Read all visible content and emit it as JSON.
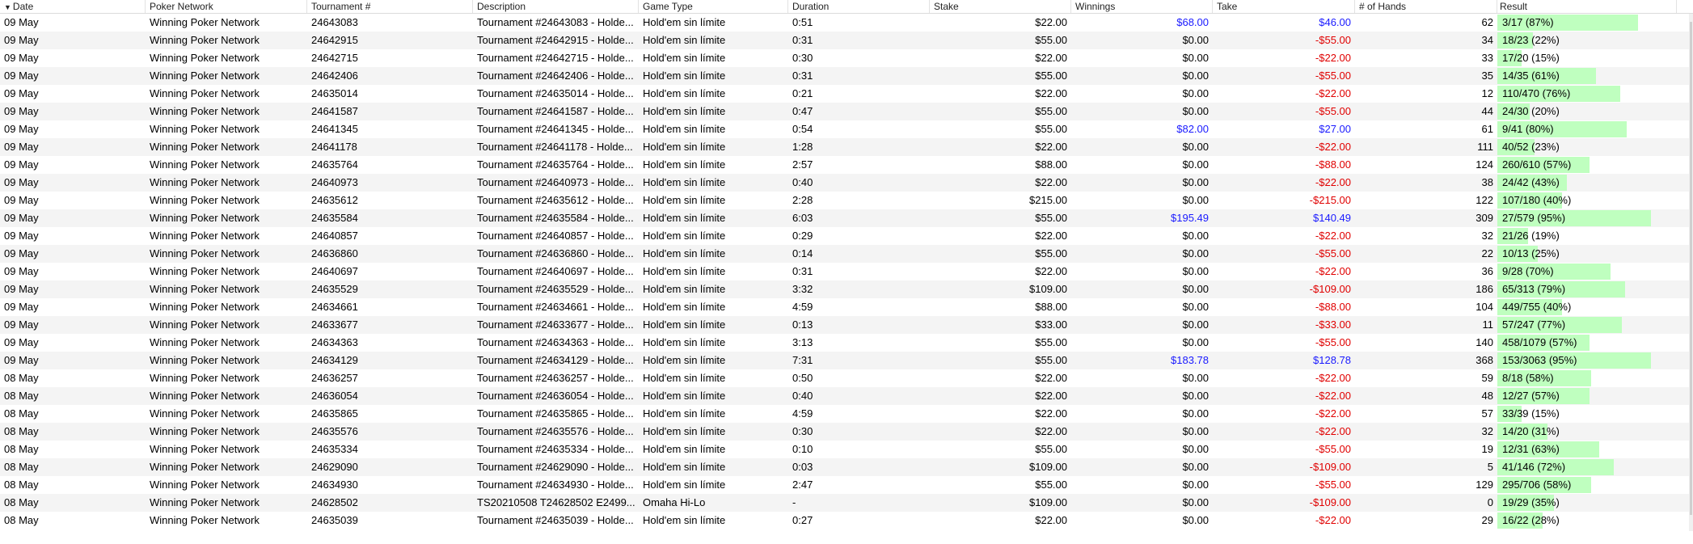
{
  "columns": {
    "date": "Date",
    "network": "Poker Network",
    "tournament": "Tournament #",
    "description": "Description",
    "game_type": "Game Type",
    "duration": "Duration",
    "stake": "Stake",
    "winnings": "Winnings",
    "take": "Take",
    "hands": "# of Hands",
    "result": "Result"
  },
  "sort_icon": "sort-descending-icon",
  "colors": {
    "positive": "#1a1aff",
    "negative": "#e00000",
    "result_bar": "#bfffbf"
  },
  "rows": [
    {
      "date": "09 May",
      "network": "Winning Poker Network",
      "tournament": "24643083",
      "description": "Tournament #24643083 - Holde...",
      "game_type": "Hold'em sin límite",
      "duration": "0:51",
      "stake": "$22.00",
      "winnings": "$68.00",
      "take": "$46.00",
      "hands": "62",
      "result": "3/17 (87%)",
      "result_pct": 87
    },
    {
      "date": "09 May",
      "network": "Winning Poker Network",
      "tournament": "24642915",
      "description": "Tournament #24642915 - Holde...",
      "game_type": "Hold'em sin límite",
      "duration": "0:31",
      "stake": "$55.00",
      "winnings": "$0.00",
      "take": "-$55.00",
      "hands": "34",
      "result": "18/23 (22%)",
      "result_pct": 22
    },
    {
      "date": "09 May",
      "network": "Winning Poker Network",
      "tournament": "24642715",
      "description": "Tournament #24642715 - Holde...",
      "game_type": "Hold'em sin límite",
      "duration": "0:30",
      "stake": "$22.00",
      "winnings": "$0.00",
      "take": "-$22.00",
      "hands": "33",
      "result": "17/20 (15%)",
      "result_pct": 15
    },
    {
      "date": "09 May",
      "network": "Winning Poker Network",
      "tournament": "24642406",
      "description": "Tournament #24642406 - Holde...",
      "game_type": "Hold'em sin límite",
      "duration": "0:31",
      "stake": "$55.00",
      "winnings": "$0.00",
      "take": "-$55.00",
      "hands": "35",
      "result": "14/35 (61%)",
      "result_pct": 61
    },
    {
      "date": "09 May",
      "network": "Winning Poker Network",
      "tournament": "24635014",
      "description": "Tournament #24635014 - Holde...",
      "game_type": "Hold'em sin límite",
      "duration": "0:21",
      "stake": "$22.00",
      "winnings": "$0.00",
      "take": "-$22.00",
      "hands": "12",
      "result": "110/470 (76%)",
      "result_pct": 76
    },
    {
      "date": "09 May",
      "network": "Winning Poker Network",
      "tournament": "24641587",
      "description": "Tournament #24641587 - Holde...",
      "game_type": "Hold'em sin límite",
      "duration": "0:47",
      "stake": "$55.00",
      "winnings": "$0.00",
      "take": "-$55.00",
      "hands": "44",
      "result": "24/30 (20%)",
      "result_pct": 20
    },
    {
      "date": "09 May",
      "network": "Winning Poker Network",
      "tournament": "24641345",
      "description": "Tournament #24641345 - Holde...",
      "game_type": "Hold'em sin límite",
      "duration": "0:54",
      "stake": "$55.00",
      "winnings": "$82.00",
      "take": "$27.00",
      "hands": "61",
      "result": "9/41 (80%)",
      "result_pct": 80
    },
    {
      "date": "09 May",
      "network": "Winning Poker Network",
      "tournament": "24641178",
      "description": "Tournament #24641178 - Holde...",
      "game_type": "Hold'em sin límite",
      "duration": "1:28",
      "stake": "$22.00",
      "winnings": "$0.00",
      "take": "-$22.00",
      "hands": "111",
      "result": "40/52 (23%)",
      "result_pct": 23
    },
    {
      "date": "09 May",
      "network": "Winning Poker Network",
      "tournament": "24635764",
      "description": "Tournament #24635764 - Holde...",
      "game_type": "Hold'em sin límite",
      "duration": "2:57",
      "stake": "$88.00",
      "winnings": "$0.00",
      "take": "-$88.00",
      "hands": "124",
      "result": "260/610 (57%)",
      "result_pct": 57
    },
    {
      "date": "09 May",
      "network": "Winning Poker Network",
      "tournament": "24640973",
      "description": "Tournament #24640973 - Holde...",
      "game_type": "Hold'em sin límite",
      "duration": "0:40",
      "stake": "$22.00",
      "winnings": "$0.00",
      "take": "-$22.00",
      "hands": "38",
      "result": "24/42 (43%)",
      "result_pct": 43
    },
    {
      "date": "09 May",
      "network": "Winning Poker Network",
      "tournament": "24635612",
      "description": "Tournament #24635612 - Holde...",
      "game_type": "Hold'em sin límite",
      "duration": "2:28",
      "stake": "$215.00",
      "winnings": "$0.00",
      "take": "-$215.00",
      "hands": "122",
      "result": "107/180 (40%)",
      "result_pct": 40
    },
    {
      "date": "09 May",
      "network": "Winning Poker Network",
      "tournament": "24635584",
      "description": "Tournament #24635584 - Holde...",
      "game_type": "Hold'em sin límite",
      "duration": "6:03",
      "stake": "$55.00",
      "winnings": "$195.49",
      "take": "$140.49",
      "hands": "309",
      "result": "27/579 (95%)",
      "result_pct": 95
    },
    {
      "date": "09 May",
      "network": "Winning Poker Network",
      "tournament": "24640857",
      "description": "Tournament #24640857 - Holde...",
      "game_type": "Hold'em sin límite",
      "duration": "0:29",
      "stake": "$22.00",
      "winnings": "$0.00",
      "take": "-$22.00",
      "hands": "32",
      "result": "21/26 (19%)",
      "result_pct": 19
    },
    {
      "date": "09 May",
      "network": "Winning Poker Network",
      "tournament": "24636860",
      "description": "Tournament #24636860 - Holde...",
      "game_type": "Hold'em sin límite",
      "duration": "0:14",
      "stake": "$55.00",
      "winnings": "$0.00",
      "take": "-$55.00",
      "hands": "22",
      "result": "10/13 (25%)",
      "result_pct": 25
    },
    {
      "date": "09 May",
      "network": "Winning Poker Network",
      "tournament": "24640697",
      "description": "Tournament #24640697 - Holde...",
      "game_type": "Hold'em sin límite",
      "duration": "0:31",
      "stake": "$22.00",
      "winnings": "$0.00",
      "take": "-$22.00",
      "hands": "36",
      "result": "9/28 (70%)",
      "result_pct": 70
    },
    {
      "date": "09 May",
      "network": "Winning Poker Network",
      "tournament": "24635529",
      "description": "Tournament #24635529 - Holde...",
      "game_type": "Hold'em sin límite",
      "duration": "3:32",
      "stake": "$109.00",
      "winnings": "$0.00",
      "take": "-$109.00",
      "hands": "186",
      "result": "65/313 (79%)",
      "result_pct": 79
    },
    {
      "date": "09 May",
      "network": "Winning Poker Network",
      "tournament": "24634661",
      "description": "Tournament #24634661 - Holde...",
      "game_type": "Hold'em sin límite",
      "duration": "4:59",
      "stake": "$88.00",
      "winnings": "$0.00",
      "take": "-$88.00",
      "hands": "104",
      "result": "449/755 (40%)",
      "result_pct": 40
    },
    {
      "date": "09 May",
      "network": "Winning Poker Network",
      "tournament": "24633677",
      "description": "Tournament #24633677 - Holde...",
      "game_type": "Hold'em sin límite",
      "duration": "0:13",
      "stake": "$33.00",
      "winnings": "$0.00",
      "take": "-$33.00",
      "hands": "11",
      "result": "57/247 (77%)",
      "result_pct": 77
    },
    {
      "date": "09 May",
      "network": "Winning Poker Network",
      "tournament": "24634363",
      "description": "Tournament #24634363 - Holde...",
      "game_type": "Hold'em sin límite",
      "duration": "3:13",
      "stake": "$55.00",
      "winnings": "$0.00",
      "take": "-$55.00",
      "hands": "140",
      "result": "458/1079 (57%)",
      "result_pct": 57
    },
    {
      "date": "09 May",
      "network": "Winning Poker Network",
      "tournament": "24634129",
      "description": "Tournament #24634129 - Holde...",
      "game_type": "Hold'em sin límite",
      "duration": "7:31",
      "stake": "$55.00",
      "winnings": "$183.78",
      "take": "$128.78",
      "hands": "368",
      "result": "153/3063 (95%)",
      "result_pct": 95
    },
    {
      "date": "08 May",
      "network": "Winning Poker Network",
      "tournament": "24636257",
      "description": "Tournament #24636257 - Holde...",
      "game_type": "Hold'em sin límite",
      "duration": "0:50",
      "stake": "$22.00",
      "winnings": "$0.00",
      "take": "-$22.00",
      "hands": "59",
      "result": "8/18 (58%)",
      "result_pct": 58
    },
    {
      "date": "08 May",
      "network": "Winning Poker Network",
      "tournament": "24636054",
      "description": "Tournament #24636054 - Holde...",
      "game_type": "Hold'em sin límite",
      "duration": "0:40",
      "stake": "$22.00",
      "winnings": "$0.00",
      "take": "-$22.00",
      "hands": "48",
      "result": "12/27 (57%)",
      "result_pct": 57
    },
    {
      "date": "08 May",
      "network": "Winning Poker Network",
      "tournament": "24635865",
      "description": "Tournament #24635865 - Holde...",
      "game_type": "Hold'em sin límite",
      "duration": "4:59",
      "stake": "$22.00",
      "winnings": "$0.00",
      "take": "-$22.00",
      "hands": "57",
      "result": "33/39 (15%)",
      "result_pct": 15
    },
    {
      "date": "08 May",
      "network": "Winning Poker Network",
      "tournament": "24635576",
      "description": "Tournament #24635576 - Holde...",
      "game_type": "Hold'em sin límite",
      "duration": "0:30",
      "stake": "$22.00",
      "winnings": "$0.00",
      "take": "-$22.00",
      "hands": "32",
      "result": "14/20 (31%)",
      "result_pct": 31
    },
    {
      "date": "08 May",
      "network": "Winning Poker Network",
      "tournament": "24635334",
      "description": "Tournament #24635334 - Holde...",
      "game_type": "Hold'em sin límite",
      "duration": "0:10",
      "stake": "$55.00",
      "winnings": "$0.00",
      "take": "-$55.00",
      "hands": "19",
      "result": "12/31 (63%)",
      "result_pct": 63
    },
    {
      "date": "08 May",
      "network": "Winning Poker Network",
      "tournament": "24629090",
      "description": "Tournament #24629090 - Holde...",
      "game_type": "Hold'em sin límite",
      "duration": "0:03",
      "stake": "$109.00",
      "winnings": "$0.00",
      "take": "-$109.00",
      "hands": "5",
      "result": "41/146 (72%)",
      "result_pct": 72
    },
    {
      "date": "08 May",
      "network": "Winning Poker Network",
      "tournament": "24634930",
      "description": "Tournament #24634930 - Holde...",
      "game_type": "Hold'em sin límite",
      "duration": "2:47",
      "stake": "$55.00",
      "winnings": "$0.00",
      "take": "-$55.00",
      "hands": "129",
      "result": "295/706 (58%)",
      "result_pct": 58
    },
    {
      "date": "08 May",
      "network": "Winning Poker Network",
      "tournament": "24628502",
      "description": "TS20210508 T24628502 E2499...",
      "game_type": "Omaha Hi-Lo",
      "duration": "-",
      "stake": "$109.00",
      "winnings": "$0.00",
      "take": "-$109.00",
      "hands": "0",
      "result": "19/29 (35%)",
      "result_pct": 35
    },
    {
      "date": "08 May",
      "network": "Winning Poker Network",
      "tournament": "24635039",
      "description": "Tournament #24635039 - Holde...",
      "game_type": "Hold'em sin límite",
      "duration": "0:27",
      "stake": "$22.00",
      "winnings": "$0.00",
      "take": "-$22.00",
      "hands": "29",
      "result": "16/22 (28%)",
      "result_pct": 28
    }
  ]
}
